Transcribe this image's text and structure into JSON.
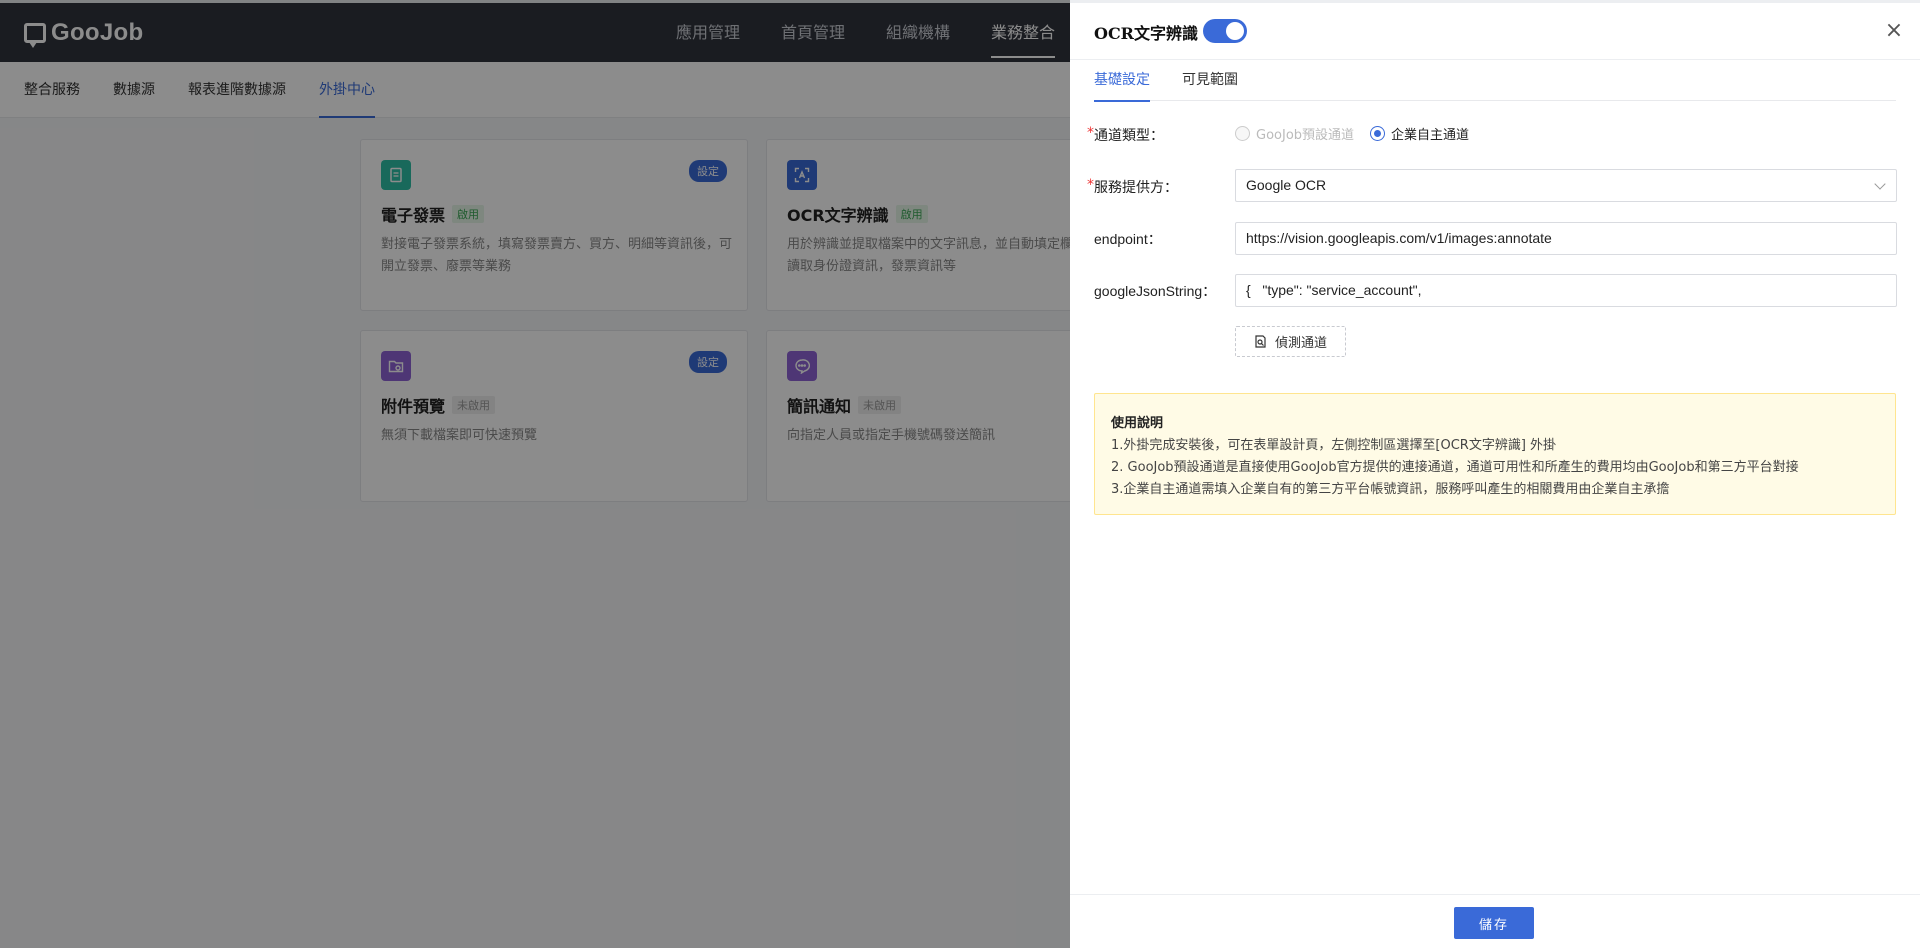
{
  "app": {
    "logo": "GooJob",
    "top_nav": [
      "應用管理",
      "首頁管理",
      "組織機構",
      "業務整合"
    ],
    "top_nav_active": "業務整合",
    "sub_nav": [
      "整合服務",
      "數據源",
      "報表進階數據源",
      "外掛中心"
    ],
    "sub_nav_active": "外掛中心"
  },
  "cards": [
    {
      "title": "電子發票",
      "status": "啟用",
      "desc": "對接電子發票系統，填寫發票賣方、買方、明細等資訊後，可開立發票、廢票等業務",
      "badge": "設定",
      "icon": "invoice-icon",
      "icon_color": "#2fbfa6"
    },
    {
      "title": "OCR文字辨識",
      "status": "啟用",
      "desc": "用於辨識並提取檔案中的文字訊息，並自動填定欄位，例如：讀取身份證資訊，發票資訊等",
      "badge": "",
      "icon": "scan-icon",
      "icon_color": "#3a6ad8"
    },
    {
      "title": "附件預覽",
      "status": "未啟用",
      "desc": "無須下載檔案即可快速預覽",
      "badge": "設定",
      "icon": "folder-icon",
      "icon_color": "#8e63d6"
    },
    {
      "title": "簡訊通知",
      "status": "未啟用",
      "desc": "向指定人員或指定手機號碼發送簡訊",
      "badge": "",
      "icon": "message-icon",
      "icon_color": "#8e63d6"
    }
  ],
  "drawer": {
    "title": "OCR文字辨識",
    "enabled": true,
    "tabs": [
      "基礎設定",
      "可見範圍"
    ],
    "active_tab": "基礎設定",
    "form": {
      "channel_label": "通道類型：",
      "channel_options": [
        "GooJob預設通道",
        "企業自主通道"
      ],
      "channel_selected": "企業自主通道",
      "provider_label": "服務提供方：",
      "provider_value": "Google OCR",
      "endpoint_label": "endpoint：",
      "endpoint_value": "https://vision.googleapis.com/v1/images:annotate",
      "json_label": "googleJsonString：",
      "json_value": "{   \"type\": \"service_account\",",
      "detect_button": "偵測通道"
    },
    "notice": {
      "title": "使用說明",
      "lines": [
        "1.外掛完成安裝後，可在表單設計頁，左側控制區選擇至[OCR文字辨識] 外掛",
        "2. GooJob預設通道是直接使用GooJob官方提供的連接通道，通道可用性和所產生的費用均由GooJob和第三方平台對接",
        "3.企業自主通道需填入企業自有的第三方平台帳號資訊，服務呼叫產生的相關費用由企業自主承擔"
      ]
    },
    "save_button": "儲存"
  }
}
